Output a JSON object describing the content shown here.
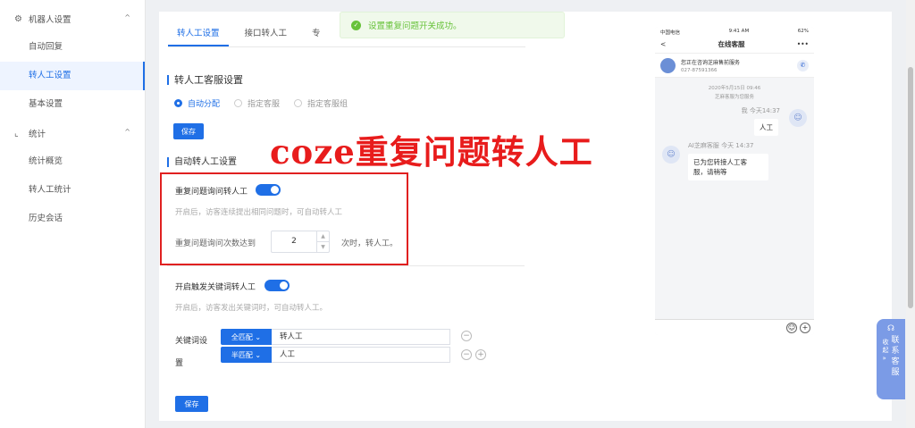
{
  "sidebar": {
    "groups": [
      {
        "label": "机器人设置",
        "icon": "gear-icon",
        "arrow": "^",
        "items": [
          "自动回复",
          "转人工设置",
          "基本设置"
        ]
      },
      {
        "label": "统计",
        "icon": "chart-icon",
        "arrow": "^",
        "items": [
          "统计概览",
          "转人工统计",
          "历史会话"
        ]
      }
    ],
    "active_item": "转人工设置"
  },
  "tabs": [
    "转人工设置",
    "接口转人工",
    "专"
  ],
  "toast": {
    "message": "设置重复问题开关成功。"
  },
  "section1": {
    "title": "转人工客服设置",
    "radios": [
      "自动分配",
      "指定客服",
      "指定客服组"
    ],
    "selected": "自动分配",
    "save": "保存"
  },
  "section2": {
    "title": "自动转人工设置",
    "repeat": {
      "label": "重复问题询问转人工",
      "enabled": true,
      "hint": "开启后，访客连续提出相同问题时，可自动转人工",
      "count_label": "重复问题询问次数达到",
      "count_value": "2",
      "count_suffix": "次时，转人工。"
    },
    "keyword": {
      "label": "开启触发关键词转人工",
      "enabled": true,
      "hint": "开启后，访客发出关键词时，可自动转人工。",
      "settings_label_1": "关键词设",
      "settings_label_2": "置",
      "rows": [
        {
          "match": "全匹配 ⌄",
          "keyword": "转人工"
        },
        {
          "match": "半匹配 ⌄",
          "keyword": "人工"
        }
      ]
    },
    "save": "保存"
  },
  "overlay": {
    "text": "coze重复问题转人工"
  },
  "phone": {
    "status_left": "中国电信",
    "status_center": "9:41 AM",
    "status_right": "62%",
    "back": "<",
    "title": "在线客服",
    "more": "•••",
    "card_title": "您正在咨询芝麻售前服务",
    "card_phone": "027-87591366",
    "date": "2020年5月15日 09:46",
    "date_note": "芝麻客服为您服务",
    "user_name": "我 今天14:37",
    "user_msg": "人工",
    "bot_name": "AI芝麻客服 今天 14:37",
    "bot_msg_1": "已为您转接人工客",
    "bot_msg_2": "服，请稍等",
    "emoji": "☺",
    "plus": "+"
  },
  "contact": {
    "col1": [
      "收",
      "起",
      "»"
    ],
    "col2": [
      "联",
      "系",
      "客",
      "服"
    ]
  }
}
